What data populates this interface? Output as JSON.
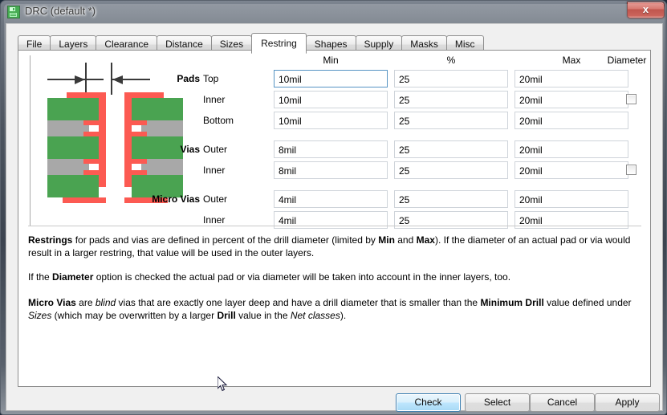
{
  "window": {
    "title": "DRC (default *)",
    "icon": "save-floppy-icon",
    "close_label": "x"
  },
  "tabs": [
    {
      "label": "File",
      "active": false
    },
    {
      "label": "Layers",
      "active": false
    },
    {
      "label": "Clearance",
      "active": false
    },
    {
      "label": "Distance",
      "active": false
    },
    {
      "label": "Sizes",
      "active": false
    },
    {
      "label": "Restring",
      "active": true
    },
    {
      "label": "Shapes",
      "active": false
    },
    {
      "label": "Supply",
      "active": false
    },
    {
      "label": "Masks",
      "active": false
    },
    {
      "label": "Misc",
      "active": false
    }
  ],
  "form": {
    "columns": {
      "min": "Min",
      "percent": "%",
      "max": "Max",
      "diameter": "Diameter"
    },
    "groups": [
      {
        "name": "Pads",
        "rows": [
          {
            "label": "Top",
            "min": "10mil",
            "percent": "25",
            "max": "20mil",
            "focused": true,
            "checkbox": false
          },
          {
            "label": "Inner",
            "min": "10mil",
            "percent": "25",
            "max": "20mil",
            "focused": false,
            "checkbox": true,
            "checked": false
          },
          {
            "label": "Bottom",
            "min": "10mil",
            "percent": "25",
            "max": "20mil",
            "focused": false,
            "checkbox": false
          }
        ]
      },
      {
        "name": "Vias",
        "rows": [
          {
            "label": "Outer",
            "min": "8mil",
            "percent": "25",
            "max": "20mil",
            "focused": false,
            "checkbox": false
          },
          {
            "label": "Inner",
            "min": "8mil",
            "percent": "25",
            "max": "20mil",
            "focused": false,
            "checkbox": true,
            "checked": false
          }
        ]
      },
      {
        "name": "Micro Vias",
        "rows": [
          {
            "label": "Outer",
            "min": "4mil",
            "percent": "25",
            "max": "20mil",
            "focused": false,
            "checkbox": false
          },
          {
            "label": "Inner",
            "min": "4mil",
            "percent": "25",
            "max": "20mil",
            "focused": false,
            "checkbox": false
          }
        ]
      }
    ]
  },
  "help": {
    "p1_a": "Restrings",
    "p1_b": " for pads and vias are defined in percent of the drill diameter (limited by ",
    "p1_c": "Min",
    "p1_d": " and ",
    "p1_e": "Max",
    "p1_f": "). If the diameter of an actual pad or via would result in a larger restring, that value will be used in the outer layers.",
    "p2_a": "If the ",
    "p2_b": "Diameter",
    "p2_c": " option is checked the actual pad or via diameter will be taken into account in the inner layers, too.",
    "p3_a": "Micro Vias",
    "p3_b": " are ",
    "p3_c": "blind",
    "p3_d": " vias that are exactly one layer deep and have a drill diameter that is smaller than the ",
    "p3_e": "Minimum Drill",
    "p3_f": " value defined under ",
    "p3_g": "Sizes",
    "p3_h": " (which may be overwritten by a larger ",
    "p3_i": "Drill",
    "p3_j": " value in the ",
    "p3_k": "Net classes",
    "p3_l": ")."
  },
  "buttons": {
    "check": "Check",
    "select": "Select",
    "cancel": "Cancel",
    "apply": "Apply"
  },
  "colors": {
    "copper": "#fc5a52",
    "layer_green": "#4aa351",
    "layer_gray": "#a8a8a8",
    "focus_border": "#5794c4",
    "default_button": "#3c7fb1"
  }
}
